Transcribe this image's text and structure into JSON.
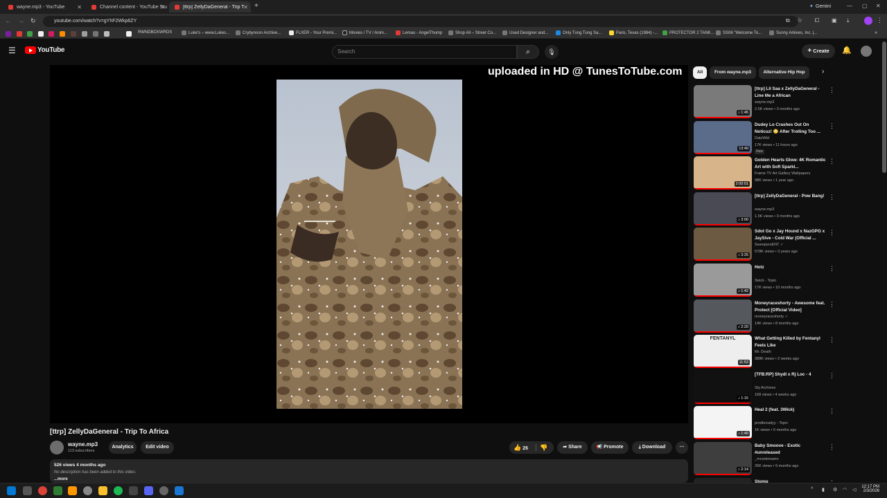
{
  "browser": {
    "tabs": [
      {
        "label": "wayne.mp3 - YouTube"
      },
      {
        "label": "Channel content - YouTube Stu"
      },
      {
        "label": "[ttrp] ZellyDaGeneral - Trip To A"
      }
    ],
    "new_tab": "+",
    "gemini_label": "Gemini",
    "url": "youtube.com/watch?v=gYhF2Wkp6ZY",
    "bookmarks": [
      "RWNDBCKWRDS",
      "Luke's – www.Lukes...",
      "Crybynoon Archive...",
      "FLXER - Your Premi...",
      "Movies / TV / Anim...",
      "Lemao - AngelThump",
      "Shop All – Street Co...",
      "Used Designer and...",
      "Only Tung Tung Sa...",
      "Paris, Texas (1984) -...",
      "PROTECTOR 2 TANK...",
      "SS06 \"Welcome To...",
      "Sunny Arkives, Inc. |..."
    ]
  },
  "youtube": {
    "logo_text": "YouTube",
    "search_placeholder": "Search",
    "create_label": "Create"
  },
  "video": {
    "watermark": "uploaded in HD @ TunesToTube.com",
    "title": "[ttrp] ZellyDaGeneral - Trip To Africa",
    "channel": "wayne.mp3",
    "subscribers": "113 subscribers",
    "analytics_label": "Analytics",
    "edit_label": "Edit video",
    "likes": "26",
    "share_label": "Share",
    "promote_label": "Promote",
    "download_label": "Download",
    "views_age": "526 views  4 months ago",
    "description": "No description has been added to this video.",
    "more": "...more"
  },
  "sidebar": {
    "chips": [
      "All",
      "From wayne.mp3",
      "Alternative Hip Hop"
    ],
    "recommendations": [
      {
        "title": "[ttrp] Lil Saa x ZellyDaGeneral - Line Me a African",
        "channel": "wayne.mp3",
        "meta": "2.6K views • 3 months ago",
        "duration": "1:45",
        "music": true,
        "thumb": "#7a7a7a"
      },
      {
        "title": "Dudey Lo Crashes Out On Noticuz! 😳 After Trolling Too ...",
        "channel": "DatzWtd",
        "meta": "17K views • 11 hours ago",
        "duration": "13:40",
        "badge": "New",
        "music": false,
        "thumb": "#5b6b8a"
      },
      {
        "title": "Golden Hearts Glow: 4K Romantic Art with Soft Sparkl...",
        "channel": "Frame TV Art Gallery Wallpapers",
        "meta": "98K views • 1 year ago",
        "duration": "2:00:01",
        "music": false,
        "thumb": "#d8b48a"
      },
      {
        "title": "[ttrp] ZellyDaGeneral - Pow Bang!",
        "channel": "wayne.mp3",
        "meta": "1.5K views • 3 months ago",
        "duration": "3:00",
        "music": true,
        "thumb": "#4a4a55"
      },
      {
        "title": "Sdot Go x Jay Hound x NazGPG x JaySive - Cold War (Official ...",
        "channel": "SweepersENT ✓",
        "meta": "578K views • 3 years ago",
        "duration": "3:25",
        "music": true,
        "thumb": "#6d5a43"
      },
      {
        "title": "Hotz",
        "channel": "3wick - Topic",
        "meta": "17K views • 10 months ago",
        "duration": "1:42",
        "music": true,
        "thumb": "#9a9a9a"
      },
      {
        "title": "Moneyraceshorty - Awesome feat. Protect [Official Video]",
        "channel": "moneyraceshorty ✓",
        "meta": "14K views • 8 months ago",
        "duration": "2:20",
        "music": true,
        "thumb": "#55595e"
      },
      {
        "title": "What Getting Killed by Fentanyl Feels Like",
        "channel": "Mr. Death",
        "meta": "388K views • 2 weeks ago",
        "duration": "11:53",
        "music": false,
        "thumb": "#eeeeee",
        "thumb_text": "FENTANYL"
      },
      {
        "title": "[TFB:RP] Shydi x Rj Loc - 4",
        "channel": "Sty Archives",
        "meta": "168 views • 4 weeks ago",
        "duration": "1:15",
        "music": true,
        "thumb": "#111111"
      },
      {
        "title": "Heal 2 (feat. 3Wick)",
        "channel": "prodbreadyy - Topic",
        "meta": "1K views • 5 months ago",
        "duration": "1:40",
        "music": true,
        "thumb": "#f4f4f4"
      },
      {
        "title": "Baby Smoove - Exotic #unreleased",
        "channel": "_mrunknownn",
        "meta": "26K views • 9 months ago",
        "duration": "2:14",
        "music": true,
        "thumb": "#3e3e3e"
      },
      {
        "title": "Stomp",
        "channel": "",
        "meta": "",
        "duration": "",
        "music": false,
        "thumb": "#222222"
      }
    ]
  },
  "taskbar": {
    "time": "12:17 PM",
    "date": "2/3/2026"
  }
}
